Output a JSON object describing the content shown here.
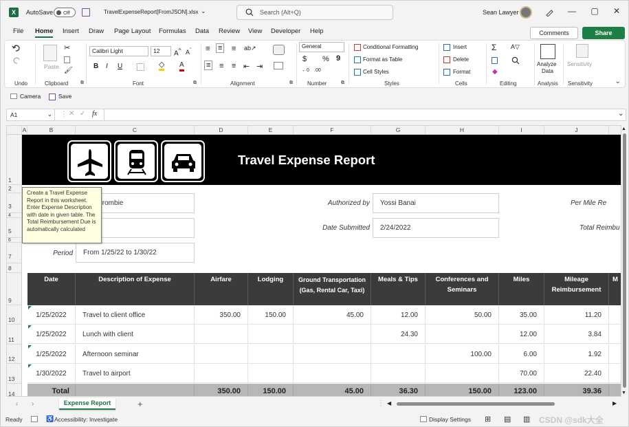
{
  "app": {
    "logo": "X",
    "autosave_label": "AutoSave",
    "autosave_state": "Off",
    "filename": "TravelExpenseReport[FromJSON].xlsx",
    "filename_chevron": "⌄",
    "search_placeholder": "Search (Alt+Q)",
    "user_name": "Sean Lawyer",
    "window": {
      "minimize": "—",
      "restore": "▢",
      "close": "✕"
    }
  },
  "tabs": [
    "File",
    "Home",
    "Insert",
    "Draw",
    "Page Layout",
    "Formulas",
    "Data",
    "Review",
    "View",
    "Developer",
    "Help"
  ],
  "active_tab": "Home",
  "actions": {
    "comments": "Comments",
    "share": "Share"
  },
  "ribbon": {
    "groups": [
      "Undo",
      "Clipboard",
      "Font",
      "Alignment",
      "Number",
      "Styles",
      "Cells",
      "Editing",
      "Analysis",
      "Sensitivity"
    ],
    "paste": "Paste",
    "font_name": "Calibri Light",
    "font_size": "12",
    "number_format": "General",
    "styles": [
      "Conditional Formatting",
      "Format as Table",
      "Cell Styles"
    ],
    "cells": [
      "Insert",
      "Delete",
      "Format"
    ],
    "analyze": [
      "Analyze",
      "Data"
    ],
    "sensitivity": "Sensitivity"
  },
  "qat": {
    "camera": "Camera",
    "save": "Save"
  },
  "formula_bar": {
    "name_box": "A1",
    "fx": "fx",
    "value": ""
  },
  "columns": [
    "A",
    "B",
    "C",
    "D",
    "E",
    "F",
    "G",
    "H",
    "I",
    "J"
  ],
  "rows": [
    "1",
    "2",
    "3",
    "4",
    "5",
    "6",
    "7",
    "8",
    "9",
    "10",
    "11",
    "12",
    "13",
    "14"
  ],
  "sheet": {
    "title": "Travel Expense Report",
    "comment": "Create a Travel Expense Report in this worksheet. Enter Expense Description with date in given table. The Total Reimbursement Due is automatically calculated",
    "name_partial": "mbercrombie",
    "authorized_by_label": "Authorized by",
    "authorized_by_value": "Yossi Banai",
    "date_submitted_label": "Date Submitted",
    "date_submitted_value": "2/24/2022",
    "per_mile_label": "Per Mile Re",
    "total_reimb_label": "Total Reimbu",
    "period_label": "Period",
    "period_value": "From 1/25/22 to 1/30/22",
    "headers": [
      "Date",
      "Description of Expense",
      "Airfare",
      "Lodging",
      "Ground Transportation (Gas, Rental Car, Taxi)",
      "Meals & Tips",
      "Conferences and Seminars",
      "Miles",
      "Mileage Reimbursement",
      "M"
    ],
    "rows": [
      {
        "date": "1/25/2022",
        "desc": "Travel to client office",
        "airfare": "350.00",
        "lodging": "150.00",
        "ground": "45.00",
        "meals": "12.00",
        "conf": "50.00",
        "miles": "35.00",
        "mileage": "11.20"
      },
      {
        "date": "1/25/2022",
        "desc": "Lunch with client",
        "airfare": "",
        "lodging": "",
        "ground": "",
        "meals": "24.30",
        "conf": "",
        "miles": "12.00",
        "mileage": "3.84"
      },
      {
        "date": "1/25/2022",
        "desc": "Afternoon seminar",
        "airfare": "",
        "lodging": "",
        "ground": "",
        "meals": "",
        "conf": "100.00",
        "miles": "6.00",
        "mileage": "1.92"
      },
      {
        "date": "1/30/2022",
        "desc": "Travel to airport",
        "airfare": "",
        "lodging": "",
        "ground": "",
        "meals": "",
        "conf": "",
        "miles": "70.00",
        "mileage": "22.40"
      }
    ],
    "total": {
      "label": "Total",
      "airfare": "350.00",
      "lodging": "150.00",
      "ground": "45.00",
      "meals": "36.30",
      "conf": "150.00",
      "miles": "123.00",
      "mileage": "39.36"
    }
  },
  "sheet_tab": "Expense Report",
  "add_sheet": "+",
  "status": {
    "ready": "Ready",
    "accessibility": "Accessibility: Investigate",
    "display_settings": "Display Settings",
    "watermark": "CSDN @sdk大全"
  }
}
